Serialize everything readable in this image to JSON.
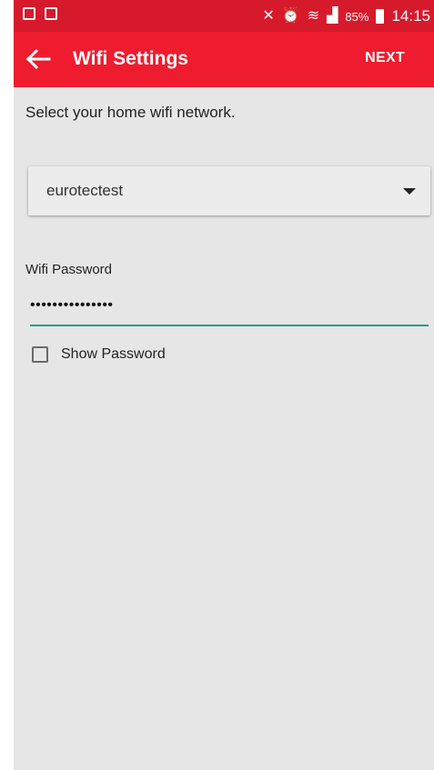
{
  "status_bar": {
    "battery": "85%",
    "time": "14:15"
  },
  "app_bar": {
    "title": "Wifi Settings",
    "next_label": "NEXT"
  },
  "content": {
    "instruction": "Select your home wifi network.",
    "network_selected": "eurotectest",
    "password_label": "Wifi Password",
    "password_value": "•••••••••••••••",
    "show_password_label": "Show Password",
    "show_password_checked": false
  },
  "colors": {
    "app_bar": "#ee1c2e",
    "status_bar": "#d61a2c",
    "accent_underline": "#1e9d8b",
    "background": "#e6e6e6"
  }
}
